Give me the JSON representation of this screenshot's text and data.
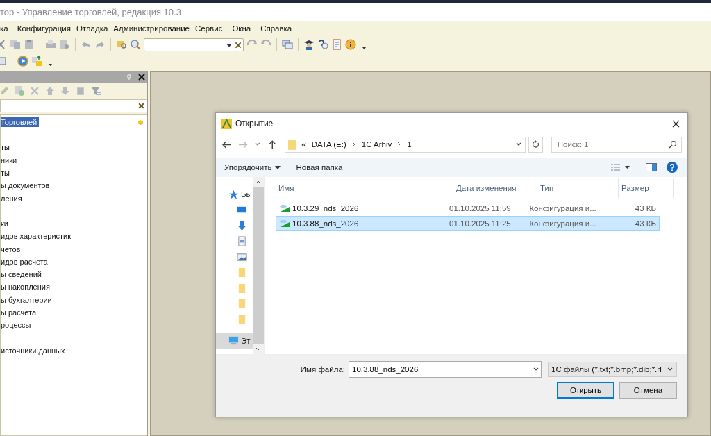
{
  "window": {
    "title": "тор - Управление торговлей, редакция 10.3"
  },
  "menu": [
    "ка",
    "Конфигурация",
    "Отладка",
    "Администрирование",
    "Сервис",
    "Окна",
    "Справка"
  ],
  "config_panel": {
    "tree_groups": [
      [
        {
          "label": "Торговлей",
          "selected": true
        }
      ],
      [
        {
          "label": "ты",
          "selected": false
        },
        {
          "label": "ники",
          "selected": false
        },
        {
          "label": "ты",
          "selected": false
        },
        {
          "label": "ы документов",
          "selected": false
        },
        {
          "label": "ления",
          "selected": false
        }
      ],
      [
        {
          "label": "ки",
          "selected": false
        },
        {
          "label": "идов характеристик",
          "selected": false
        },
        {
          "label": "четов",
          "selected": false
        },
        {
          "label": "идов расчета",
          "selected": false
        },
        {
          "label": "ы сведений",
          "selected": false
        },
        {
          "label": "ы накопления",
          "selected": false
        },
        {
          "label": "ы бухгалтерии",
          "selected": false
        },
        {
          "label": "ы расчета",
          "selected": false
        },
        {
          "label": "роцессы",
          "selected": false
        }
      ],
      [
        {
          "label": "источники данных",
          "selected": false
        }
      ]
    ]
  },
  "dialog": {
    "title": "Открытие",
    "breadcrumb": [
      "«",
      "DATA (E:)",
      "1C Arhiv",
      "1"
    ],
    "search": {
      "placeholder": "Поиск: 1"
    },
    "commands": [
      "Упорядочить",
      "Новая папка"
    ],
    "nav": [
      {
        "kind": "star",
        "label": "Бы",
        "selected": false
      },
      {
        "kind": "desktop",
        "selected": false
      },
      {
        "kind": "download",
        "selected": false
      },
      {
        "kind": "document",
        "selected": false
      },
      {
        "kind": "image",
        "selected": false
      },
      {
        "kind": "folder",
        "selected": false
      },
      {
        "kind": "folder",
        "selected": false
      },
      {
        "kind": "folder",
        "selected": false
      },
      {
        "kind": "folder",
        "selected": false
      },
      {
        "kind": "computer",
        "label": "Эт",
        "selected": true
      }
    ],
    "columns": [
      "Имя",
      "Дата изменения",
      "Тип",
      "Размер"
    ],
    "files": [
      {
        "name": "10.3.29_nds_2026",
        "date": "01.10.2025 11:59",
        "type": "Конфигурация и...",
        "size": "43 КБ",
        "selected": false
      },
      {
        "name": "10.3.88_nds_2026",
        "date": "01.10.2025 11:25",
        "type": "Конфигурация и...",
        "size": "43 КБ",
        "selected": true
      }
    ],
    "filename_label": "Имя файла:",
    "filename": "10.3.88_nds_2026",
    "filter": "1C файлы (*.txt;*.bmp;*.dib;*.rl",
    "buttons": [
      "Открыть",
      "Отмена"
    ]
  }
}
